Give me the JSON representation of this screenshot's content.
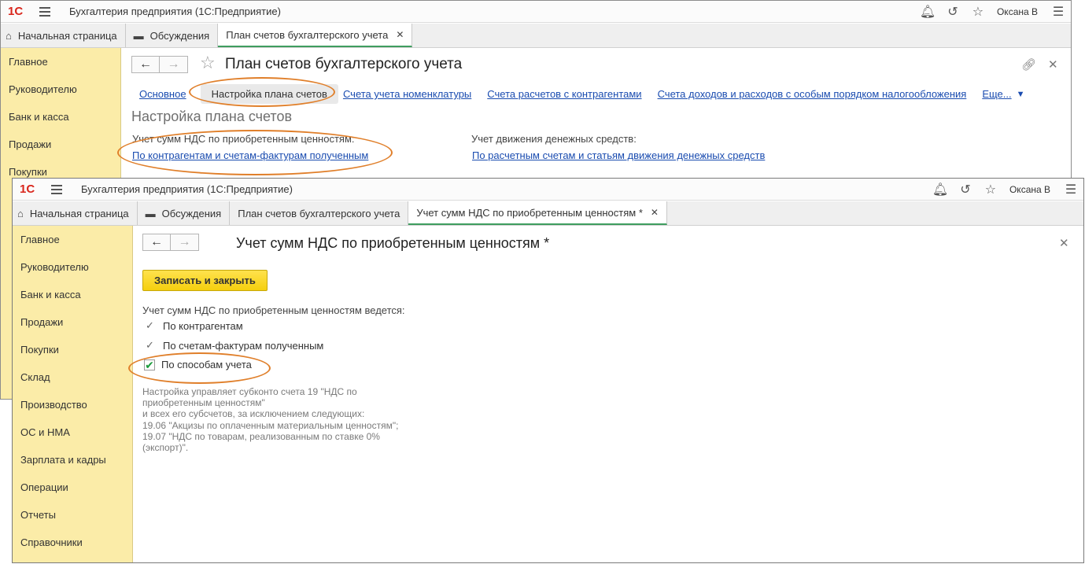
{
  "app": {
    "logo": "1С",
    "title": "Бухгалтерия предприятия  (1С:Предприятие)",
    "user": "Оксана В"
  },
  "back_window": {
    "tabs": [
      {
        "label": "Начальная страница",
        "icon": "home-icon"
      },
      {
        "label": "Обсуждения",
        "icon": "discussion-icon"
      },
      {
        "label": "План счетов бухгалтерского учета",
        "active": true
      }
    ],
    "sidebar": [
      "Главное",
      "Руководителю",
      "Банк и касса",
      "Продажи",
      "Покупки"
    ],
    "doc_title": "План счетов бухгалтерского учета",
    "section_tabs": [
      "Основное",
      "Настройка плана счетов",
      "Счета учета номенклатуры",
      "Счета расчетов с контрагентами",
      "Счета доходов и расходов с особым порядком налогообложения"
    ],
    "more_label": "Еще...",
    "section_heading": "Настройка плана счетов",
    "vat_label": "Учет сумм НДС по приобретенным ценностям:",
    "vat_link": "По контрагентам и счетам-фактурам полученным",
    "cash_label": "Учет движения денежных средств:",
    "cash_link": "По расчетным счетам и статьям движения денежных средств"
  },
  "front_window": {
    "tabs": [
      {
        "label": "Начальная страница",
        "icon": "home-icon"
      },
      {
        "label": "Обсуждения",
        "icon": "discussion-icon"
      },
      {
        "label": "План счетов бухгалтерского учета"
      },
      {
        "label": "Учет сумм НДС по приобретенным ценностям *",
        "active": true
      }
    ],
    "sidebar": [
      "Главное",
      "Руководителю",
      "Банк и касса",
      "Продажи",
      "Покупки",
      "Склад",
      "Производство",
      "ОС и НМА",
      "Зарплата и кадры",
      "Операции",
      "Отчеты",
      "Справочники"
    ],
    "doc_title": "Учет сумм НДС по приобретенным ценностям *",
    "save_button": "Записать и закрыть",
    "options_label": "Учет сумм НДС по приобретенным ценностям ведется:",
    "options": [
      {
        "label": "По контрагентам",
        "checked": true
      },
      {
        "label": "По счетам-фактурам полученным",
        "checked": true
      },
      {
        "label": "По способам учета",
        "checked": true
      }
    ],
    "note_lines": [
      "Настройка управляет субконто счета 19 \"НДС по",
      "приобретенным ценностям\"",
      "и всех его субсчетов, за исключением следующих:",
      "19.06 \"Акцизы по оплаченным материальным ценностям\";",
      "19.07 \"НДС по товарам, реализованным по ставке 0%",
      "(экспорт)\"."
    ]
  },
  "colors": {
    "sidebar_bg": "#fbeca8",
    "link": "#1a4cb0",
    "save_button": "#f5cf0e",
    "highlight_oval": "#e07f2a",
    "active_tab_underline": "#3f9d5f"
  }
}
